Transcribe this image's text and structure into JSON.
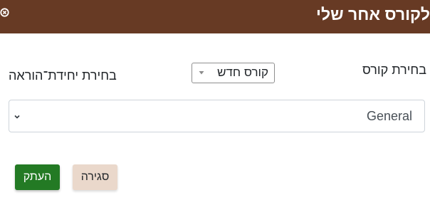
{
  "dialog": {
    "title": "לקורס אחר שלי",
    "close_icon": "circle-x-icon",
    "header_color": "#673a24"
  },
  "form": {
    "course_label": "בחירת קורס",
    "course_select": {
      "selected": "קורס חדש"
    },
    "unit_label": "בחירת יחידת־הוראה",
    "unit_select": {
      "selected": "General"
    }
  },
  "buttons": {
    "copy_label": "העתק",
    "copy_color": "#237a24",
    "close_label": "סגירה",
    "close_color": "#ead8cb"
  }
}
